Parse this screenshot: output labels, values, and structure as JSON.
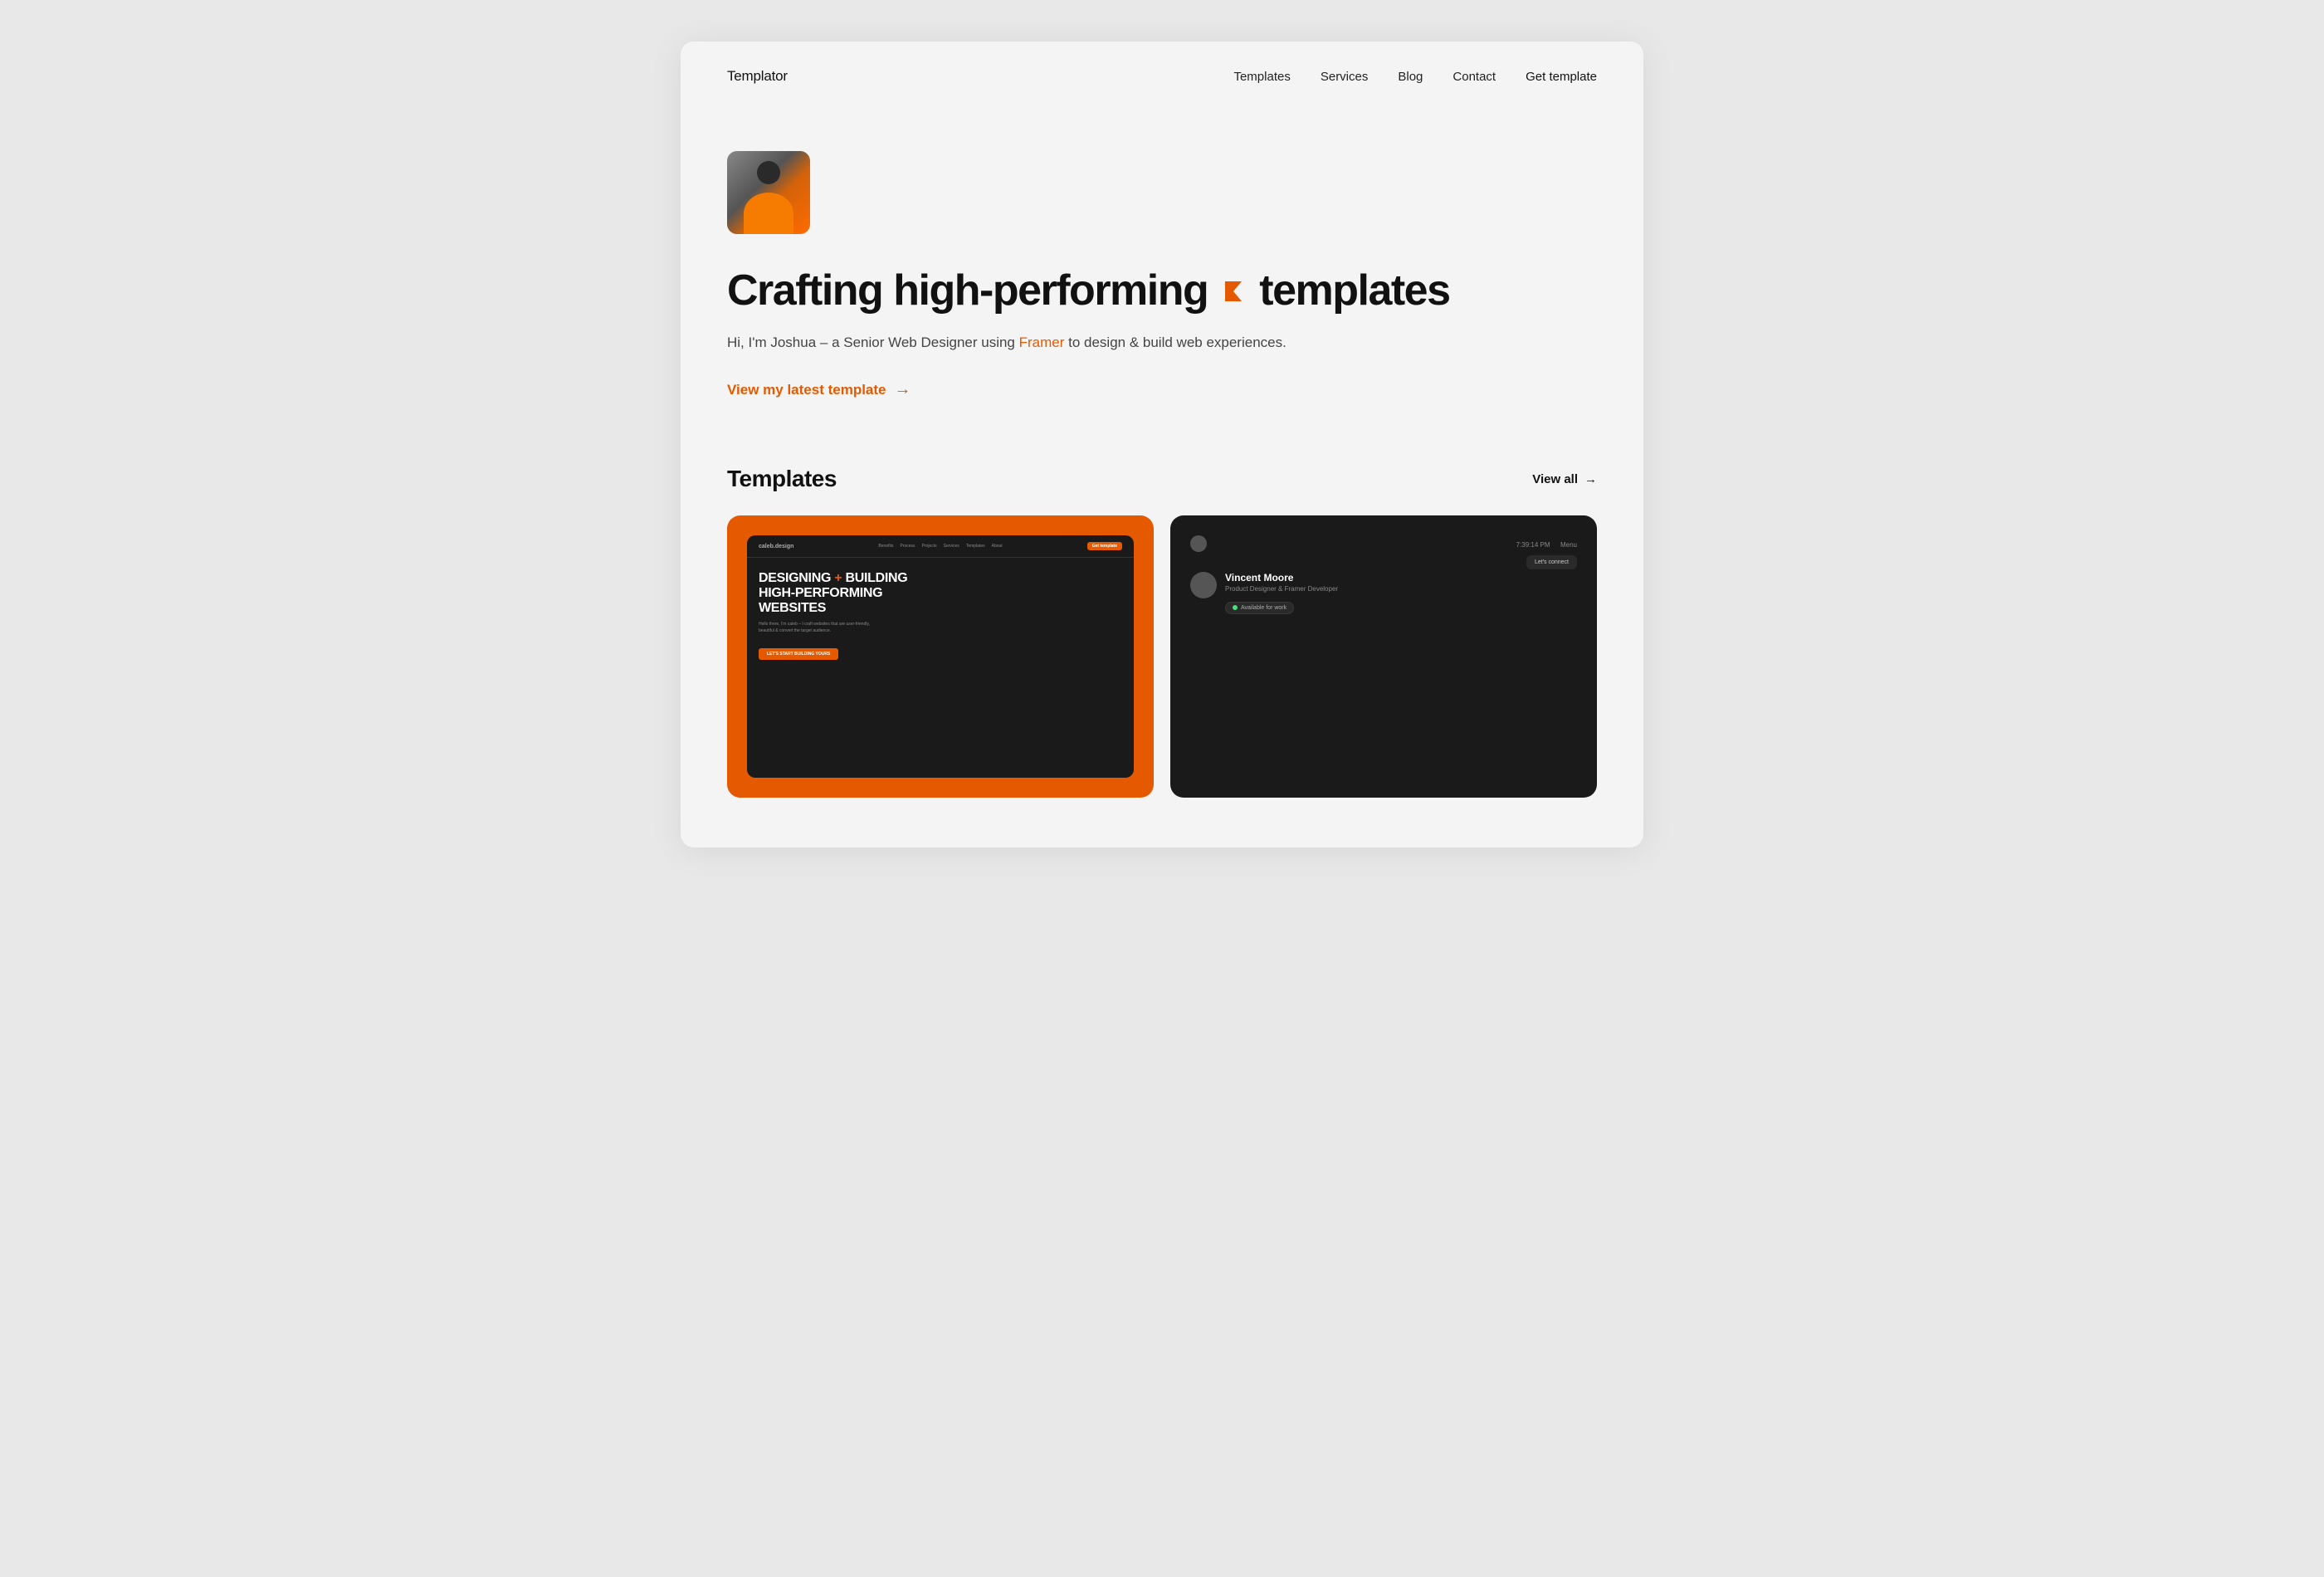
{
  "brand": {
    "logo": "Templator"
  },
  "nav": {
    "items": [
      {
        "label": "Templates",
        "id": "nav-templates"
      },
      {
        "label": "Services",
        "id": "nav-services"
      },
      {
        "label": "Blog",
        "id": "nav-blog"
      },
      {
        "label": "Contact",
        "id": "nav-contact"
      }
    ],
    "cta": "Get template"
  },
  "hero": {
    "title_start": "Crafting high-performing",
    "framer_icon": "⌗",
    "title_end": "templates",
    "subtitle_start": "Hi, I'm Joshua – a Senior Web Designer using ",
    "framer_link": "Framer",
    "subtitle_end": " to design & build web experiences.",
    "cta_label": "View my latest template",
    "cta_arrow": "→"
  },
  "templates_section": {
    "title": "Templates",
    "view_all": "View all",
    "view_all_arrow": "→",
    "cards": [
      {
        "id": "card-1",
        "theme": "orange",
        "inner_logo": "caleb.design",
        "nav_links": [
          "Benefits",
          "Process",
          "Projects",
          "Services",
          "Templates",
          "About"
        ],
        "nav_cta": "Get template",
        "headline_line1": "DESIGNING + BUILDING",
        "headline_line2": "HIGH-PERFORMING",
        "headline_line3": "WEBSITES",
        "body_text": "Hello there, I'm caleb – I craft websites that are user-friendly, beautiful & convert the target audience.",
        "cta_btn": "LET'S START BUILDING YOURS"
      },
      {
        "id": "card-2",
        "theme": "dark",
        "time": "7:39:14 PM",
        "menu": "Menu",
        "name": "Vincent Moore",
        "role": "Product Designer & Framer Developer",
        "badge": "Available for work",
        "connect_btn": "Let's connect"
      }
    ]
  }
}
